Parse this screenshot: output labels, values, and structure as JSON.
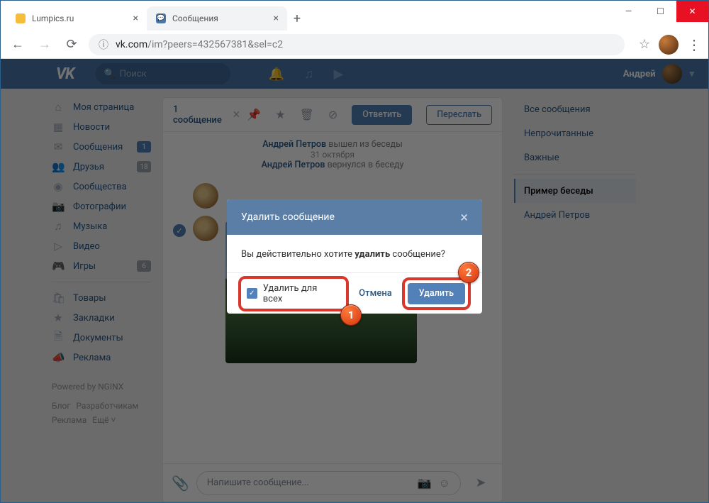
{
  "window": {
    "tabs": [
      {
        "title": "Lumpics.ru",
        "favicon_color": "#f6bd3b"
      },
      {
        "title": "Сообщения",
        "favicon_color": "#4a76a8"
      }
    ]
  },
  "browser": {
    "url_host": "vk.com",
    "url_path": "/im?peers=432567381&sel=c2"
  },
  "vk": {
    "search_placeholder": "Поиск",
    "user_name": "Андрей"
  },
  "leftnav": {
    "items": [
      {
        "label": "Моя страница",
        "icon": "⌂"
      },
      {
        "label": "Новости",
        "icon": "▦"
      },
      {
        "label": "Сообщения",
        "icon": "✉",
        "badge": "1",
        "badge_blue": true
      },
      {
        "label": "Друзья",
        "icon": "👥",
        "badge": "18"
      },
      {
        "label": "Сообщества",
        "icon": "◉"
      },
      {
        "label": "Фотографии",
        "icon": "📷"
      },
      {
        "label": "Музыка",
        "icon": "♫"
      },
      {
        "label": "Видео",
        "icon": "▷"
      },
      {
        "label": "Игры",
        "icon": "🎮",
        "badge": "6"
      }
    ],
    "items2": [
      {
        "label": "Товары",
        "icon": "🛍"
      },
      {
        "label": "Закладки",
        "icon": "★"
      },
      {
        "label": "Документы",
        "icon": "🗎"
      },
      {
        "label": "Реклама",
        "icon": "📣"
      }
    ],
    "footer_powered": "Powered by NGINX",
    "footer_links": [
      "Блог",
      "Разработчикам",
      "Реклама",
      "Ещё ˅"
    ]
  },
  "center": {
    "selected_label": "1 сообщение",
    "reply_btn": "Ответить",
    "forward_btn": "Переслать",
    "sys1_name": "Андрей Петров",
    "sys1_text": " вышел из беседы",
    "sys_date": "31 октября",
    "sys2_name": "Андрей Петров",
    "sys2_text": " вернулся в беседу",
    "compose_placeholder": "Напишите сообщение..."
  },
  "rightnav": {
    "items": [
      "Все сообщения",
      "Непрочитанные",
      "Важные"
    ],
    "active": "Пример беседы",
    "extra": "Андрей Петров"
  },
  "modal": {
    "title": "Удалить сообщение",
    "question_pre": "Вы действительно хотите ",
    "question_b": "удалить",
    "question_post": " сообщение?",
    "checkbox_label": "Удалить для всех",
    "cancel": "Отмена",
    "delete": "Удалить",
    "callout1": "1",
    "callout2": "2"
  }
}
